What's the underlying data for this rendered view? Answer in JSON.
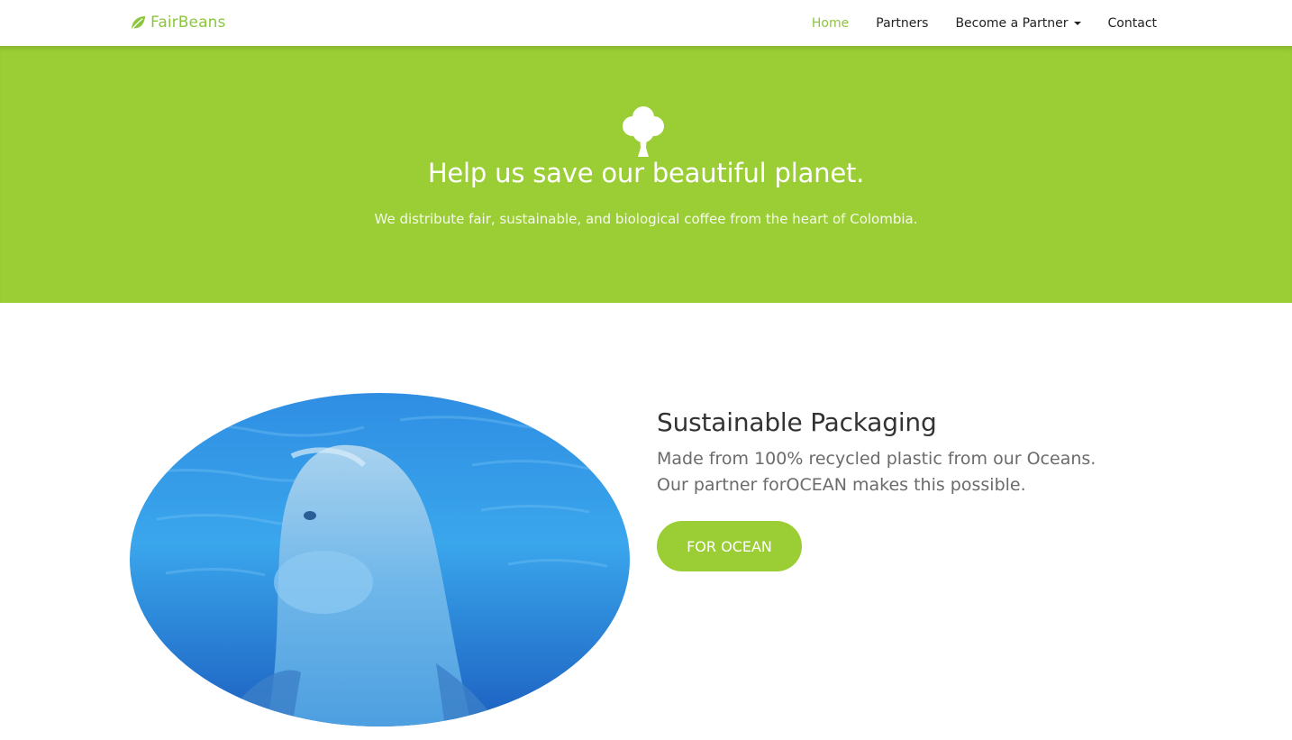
{
  "brand": {
    "name": "FairBeans",
    "icon": "leaf-icon",
    "color": "#8cc63f"
  },
  "nav": {
    "items": [
      {
        "label": "Home",
        "active": true
      },
      {
        "label": "Partners",
        "active": false
      },
      {
        "label": "Become a Partner",
        "active": false,
        "dropdown": true
      },
      {
        "label": "Contact",
        "active": false
      }
    ]
  },
  "hero": {
    "icon": "tree-icon",
    "title": "Help us save our beautiful planet.",
    "subtitle": "We distribute fair, sustainable, and biological coffee from the heart of Colombia.",
    "background": "#9ace34"
  },
  "feature": {
    "image": "dolphin-photo",
    "title": "Sustainable Packaging",
    "description_line1": "Made from 100% recycled plastic from our Oceans.",
    "description_line2": "Our partner forOCEAN makes this possible.",
    "button_label": "FOR OCEAN"
  }
}
